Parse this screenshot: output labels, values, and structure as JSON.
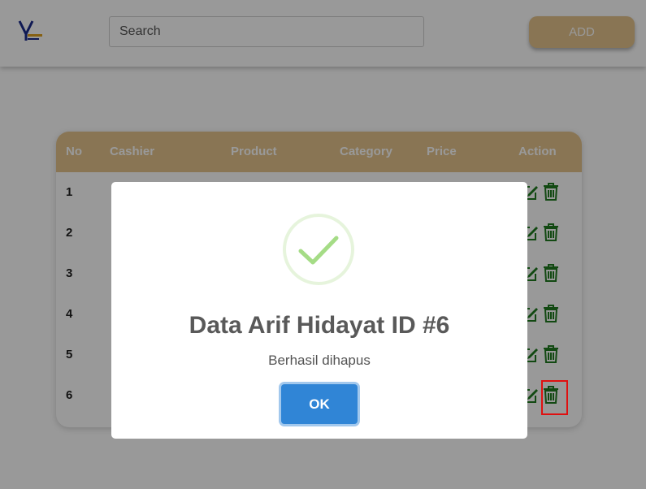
{
  "header": {
    "search_placeholder": "Search",
    "add_label": "ADD"
  },
  "table": {
    "columns": [
      "No",
      "Cashier",
      "Product",
      "Category",
      "Price",
      "Action"
    ],
    "rows": [
      {
        "no": "1"
      },
      {
        "no": "2"
      },
      {
        "no": "3"
      },
      {
        "no": "4"
      },
      {
        "no": "5"
      },
      {
        "no": "6"
      }
    ]
  },
  "modal": {
    "title": "Data Arif Hidayat ID #6",
    "text": "Berhasil dihapus",
    "ok_label": "OK"
  },
  "colors": {
    "accent": "#e4c48c",
    "action_icons": "#1f7a1f",
    "confirm_button": "#3085d6",
    "success": "#a5dc86"
  },
  "icons": {
    "logo": "brand-logo",
    "edit": "edit-icon",
    "delete": "trash-icon",
    "success": "checkmark-icon"
  }
}
